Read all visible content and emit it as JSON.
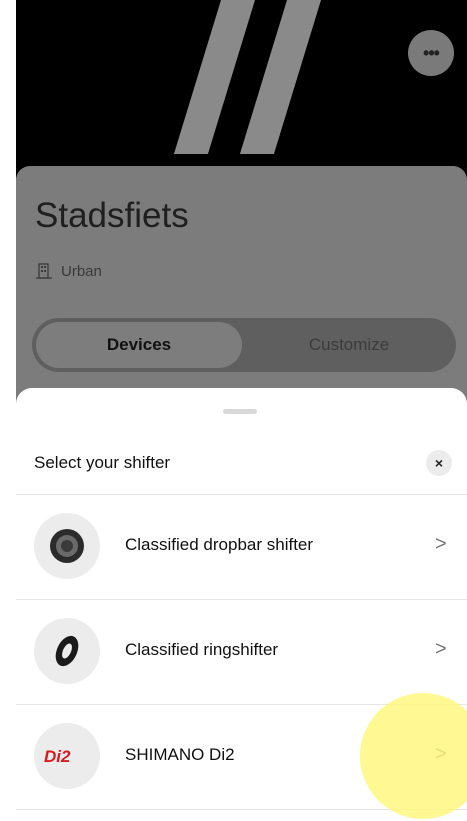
{
  "bike": {
    "name": "Stadsfiets",
    "type": "Urban"
  },
  "tabs": {
    "devices": "Devices",
    "customize": "Customize"
  },
  "header": {
    "more_icon": "more-icon",
    "more_label": "•••"
  },
  "sheet": {
    "title": "Select your shifter",
    "close_label": "×",
    "items": [
      {
        "label": "Classified dropbar shifter",
        "icon": "dropbar-shifter-icon",
        "chevron": ">"
      },
      {
        "label": "Classified ringshifter",
        "icon": "ringshifter-icon",
        "chevron": ">"
      },
      {
        "label": "SHIMANO Di2",
        "icon": "di2-logo",
        "chevron": ">"
      }
    ]
  },
  "colors": {
    "highlight": "#fff678",
    "di2_red": "#d71920"
  }
}
